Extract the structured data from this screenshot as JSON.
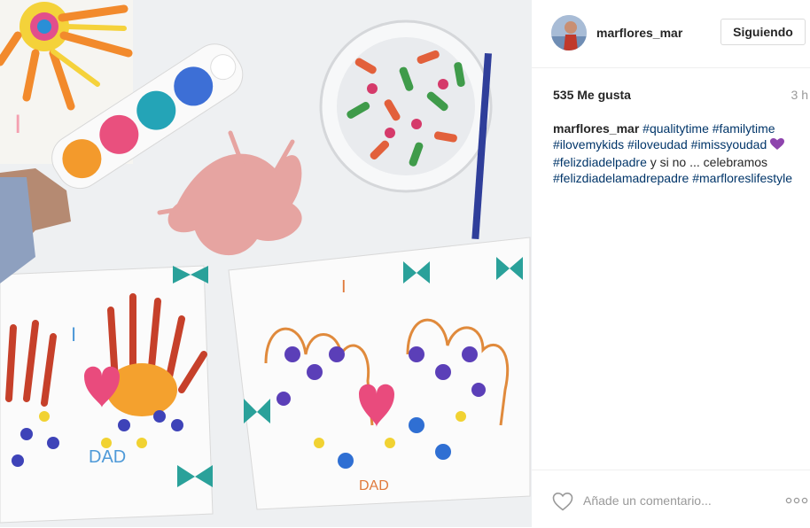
{
  "post": {
    "username": "marflores_mar",
    "follow_label": "Siguiendo",
    "likes": "535 Me gusta",
    "time": "3 h",
    "caption": {
      "user": "marflores_mar",
      "segments": [
        {
          "t": "#qualitytime",
          "tag": true
        },
        {
          "t": "#familytime",
          "tag": true
        },
        {
          "t": "#ilovemykids",
          "tag": true
        },
        {
          "t": "#iloveudad",
          "tag": true
        },
        {
          "t": "#imissyoudad",
          "tag": true
        },
        {
          "t": "#felizdiadelpadre",
          "tag": true
        },
        {
          "t": "y si no ... celebramos",
          "tag": false
        },
        {
          "t": "#felizdiadelamadrepadre",
          "tag": true
        },
        {
          "t": "#marfloreslifestyle",
          "tag": true
        }
      ]
    },
    "comment_placeholder": "Añade un comentario...",
    "icons": {
      "avatar": "avatar-image",
      "like": "heart-outline-icon",
      "more": "more-options-icon",
      "caption_emoji": "purple-heart-emoji"
    },
    "colors": {
      "hashtag": "#003569",
      "purple_heart": "#8e44ad",
      "border": "#dbdbdb"
    }
  },
  "photo": {
    "canvas_left_text": [
      "I",
      "DAD"
    ],
    "canvas_right_text": [
      "I",
      "DAD"
    ],
    "tray_text": "I"
  }
}
